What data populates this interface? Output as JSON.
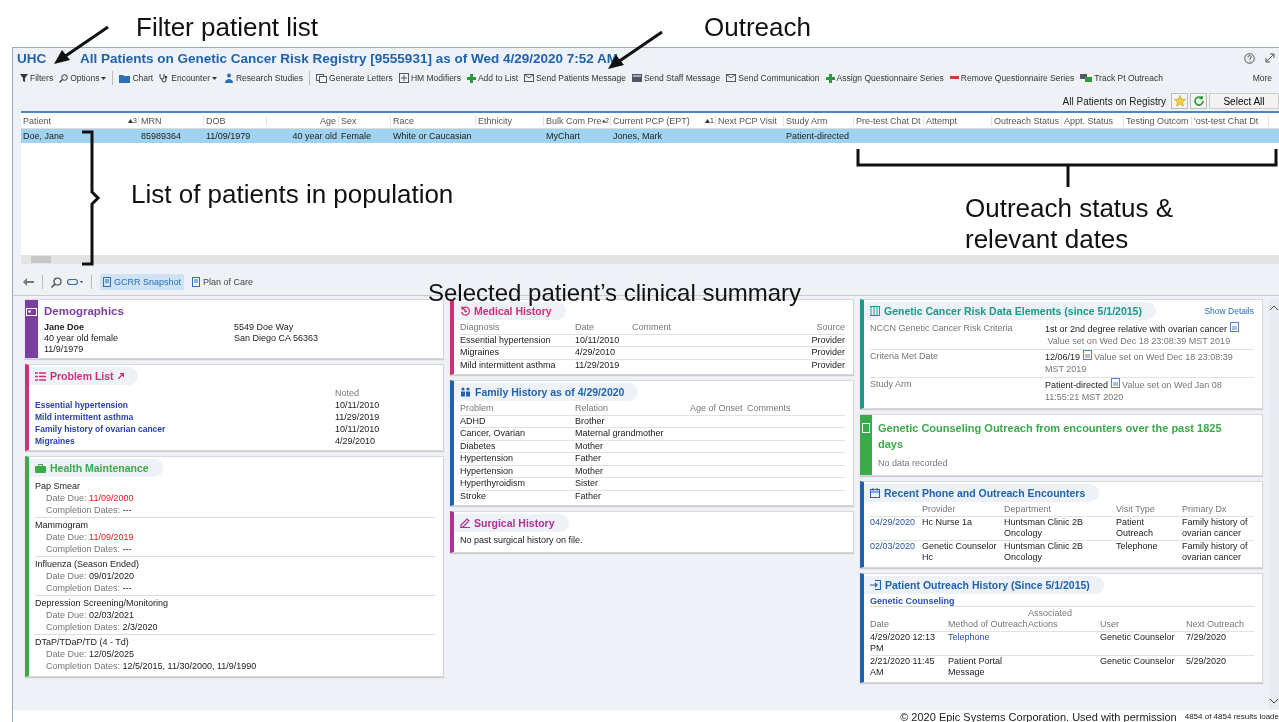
{
  "callouts": {
    "filter": "Filter patient list",
    "outreach": "Outreach",
    "patient_list": "List of patients in population",
    "outreach_status": "Outreach status & relevant dates",
    "clinical_summary": "Selected patient’s clinical summary"
  },
  "window": {
    "title_prefix": "UHC",
    "title": "All Patients on Genetic Cancer Risk Registry [9555931] as of Wed 4/29/2020  7:52 AM"
  },
  "toolbar": [
    {
      "label": "Filters",
      "dropdown": false
    },
    {
      "label": "Options",
      "dropdown": true
    },
    {
      "label": "Chart",
      "dropdown": false
    },
    {
      "label": "Encounter",
      "dropdown": true
    },
    {
      "label": "Research Studies",
      "dropdown": false
    },
    {
      "label": "Generate Letters",
      "dropdown": false
    },
    {
      "label": "HM Modifiers",
      "dropdown": false
    },
    {
      "label": "Add to List",
      "dropdown": false
    },
    {
      "label": "Send Patients Message",
      "dropdown": false
    },
    {
      "label": "Send Staff Message",
      "dropdown": false
    },
    {
      "label": "Send Communication",
      "dropdown": false
    },
    {
      "label": "Assign Questionnaire Series",
      "dropdown": false
    },
    {
      "label": "Remove Questionnaire Series",
      "dropdown": false
    },
    {
      "label": "Track Pt Outreach",
      "dropdown": false
    },
    {
      "label": "More",
      "dropdown": false
    }
  ],
  "list_bar": {
    "label": "All Patients on Registry",
    "button": "Select All"
  },
  "table": {
    "columns": [
      {
        "label": "Patient",
        "sort_rank": "3"
      },
      {
        "label": "MRN"
      },
      {
        "label": "DOB"
      },
      {
        "label": "Age"
      },
      {
        "label": "Sex"
      },
      {
        "label": "Race"
      },
      {
        "label": "Ethnicity"
      },
      {
        "label": "Bulk Com Pre",
        "sort_rank": "2"
      },
      {
        "label": "Current PCP (EPT)",
        "sort_rank": "1"
      },
      {
        "label": "Next PCP Visit"
      },
      {
        "label": "Study Arm"
      },
      {
        "label": "Pre-test Chat Dt"
      },
      {
        "label": "Attempt"
      },
      {
        "label": "Outreach Status"
      },
      {
        "label": "Appt. Status"
      },
      {
        "label": "Testing Outcom"
      },
      {
        "label": "'ost-test Chat Dt"
      }
    ],
    "rows": [
      {
        "selected": true,
        "cells": [
          "Doe, Jane",
          "85989364",
          "11/09/1979",
          "40 year old",
          "Female",
          "White or Caucasian",
          null,
          "MyChart",
          "Jones, Mark",
          null,
          "Patient-directed",
          null,
          null,
          null,
          null,
          null,
          null
        ]
      }
    ]
  },
  "snapshot_bar": {
    "tabs": [
      {
        "label": "GCRR Snapshot",
        "selected": true
      },
      {
        "label": "Plan of Care",
        "selected": false
      }
    ]
  },
  "columns": [
    [
      {
        "kind": "demographics",
        "title": "Demographics",
        "color": "#7b3fa0",
        "name": "Jane Doe",
        "lines": [
          "40 year old female",
          "11/9/1979"
        ],
        "address": [
          "5549 Doe Way",
          "San Diego CA 56363"
        ]
      },
      {
        "kind": "problems",
        "title": "Problem List",
        "color": "#d0307a",
        "noted_label": "Noted",
        "items": [
          {
            "name": "Essential hypertension",
            "date": "10/11/2010"
          },
          {
            "name": "Mild intermittent asthma",
            "date": "11/29/2019"
          },
          {
            "name": "Family history of ovarian cancer",
            "date": "10/11/2010"
          },
          {
            "name": "Migraines",
            "date": "4/29/2010"
          }
        ]
      },
      {
        "kind": "maintenance",
        "title": "Health Maintenance",
        "color": "#3aaa4a",
        "items": [
          {
            "name": "Pap Smear",
            "due_label": "Date Due:",
            "due": "11/09/2000",
            "overdue": true,
            "completion_label": "Completion Dates:",
            "completion": "---"
          },
          {
            "name": "Mammogram",
            "due_label": "Date Due:",
            "due": "11/09/2019",
            "overdue": true,
            "completion_label": "Completion Dates:",
            "completion": "---"
          },
          {
            "name": "Influenza (Season Ended)",
            "due_label": "Date Due:",
            "due": "09/01/2020",
            "overdue": false,
            "completion_label": "Completion Dates:",
            "completion": "---"
          },
          {
            "name": "Depression Screening/Monitoring",
            "due_label": "Date Due:",
            "due": "02/03/2021",
            "overdue": false,
            "completion_label": "Completion Dates:",
            "completion": "2/3/2020"
          },
          {
            "name": "DTaP/TDaP/TD (4 - Td)",
            "due_label": "Date Due:",
            "due": "12/05/2025",
            "overdue": false,
            "completion_label": "Completion Dates:",
            "completion": "12/5/2015, 11/30/2000, 11/9/1990"
          }
        ]
      }
    ],
    [
      {
        "kind": "table",
        "title": "Medical History",
        "color": "#d0307a",
        "columns": [
          "Diagnosis",
          "Date",
          "Comment",
          "Source"
        ],
        "rows": [
          [
            "Essential hypertension",
            "10/11/2010",
            null,
            "Provider"
          ],
          [
            "Migraines",
            "4/29/2010",
            null,
            "Provider"
          ],
          [
            "Mild intermittent asthma",
            "11/29/2019",
            null,
            "Provider"
          ]
        ]
      },
      {
        "kind": "table",
        "title": "Family History as of 4/29/2020",
        "color": "#1f63b0",
        "columns": [
          "Problem",
          "Relation",
          "Age of Onset",
          "Comments"
        ],
        "rows": [
          [
            "ADHD",
            "Brother",
            null,
            null
          ],
          [
            "Cancer, Ovarian",
            "Maternal grandmother",
            null,
            null
          ],
          [
            "Diabetes",
            "Mother",
            null,
            null
          ],
          [
            "Hypertension",
            "Father",
            null,
            null
          ],
          [
            "Hypertension",
            "Mother",
            null,
            null
          ],
          [
            "Hyperthyroidism",
            "Sister",
            null,
            null
          ],
          [
            "Stroke",
            "Father",
            null,
            null
          ]
        ]
      },
      {
        "kind": "text",
        "title": "Surgical History",
        "color": "#b0309a",
        "text": "No past surgical history on file."
      }
    ],
    [
      {
        "kind": "data_elements",
        "title": "Genetic Cancer Risk Data Elements (since 5/1/2015)",
        "color": "#1a9a8a",
        "action": "Show Details",
        "rows": [
          {
            "label": "NCCN Genetic Cancer Risk Criteria",
            "value": "1st or 2nd degree relative with ovarian cancer",
            "note": "Value set on Wed Dec 18 23:08:39 MST 2019"
          },
          {
            "label": "Criteria Met Date",
            "value": "12/06/19",
            "note": "Value set on Wed Dec 18 23:08:39 MST 2019"
          },
          {
            "label": "Study Arm",
            "value": "Patient-directed",
            "note": "Value set on Wed Jan 08 11:55:21 MST 2020"
          }
        ]
      },
      {
        "kind": "notice",
        "title": "Genetic Counseling Outreach from encounters over the past 1825 days",
        "color": "#3aaa4a",
        "text": "No data recorded"
      },
      {
        "kind": "table",
        "title": "Recent Phone and Outreach Encounters",
        "color": "#1f63b0",
        "columns": [
          null,
          "Provider",
          "Department",
          "Visit Type",
          "Primary Dx"
        ],
        "rows": [
          [
            "04/29/2020",
            "Hc Nurse 1a",
            "Huntsman Clinic 2B Oncology",
            "Patient Outreach",
            "Family history of ovarian cancer"
          ],
          [
            "02/03/2020",
            "Genetic Counselor Hc",
            "Huntsman Clinic 2B Oncology",
            "Telephone",
            "Family history of ovarian cancer"
          ]
        ]
      },
      {
        "kind": "outreach_history",
        "title": "Patient Outreach History (Since 5/1/2015)",
        "color": "#1f63b0",
        "section": "Genetic Counseling",
        "columns": [
          "Date",
          "Method of Outreach",
          "Associated Actions",
          "User",
          "Next Outreach"
        ],
        "rows": [
          [
            "4/29/2020 12:13 PM",
            "Telephone",
            null,
            "Genetic Counselor",
            "7/29/2020"
          ],
          [
            "2/21/2020 11:45 AM",
            "Patient Portal Message",
            null,
            "Genetic Counselor",
            "5/29/2020"
          ]
        ]
      }
    ]
  ],
  "footer": {
    "copyright": "© 2020 Epic Systems Corporation. Used with permission",
    "results": "4854 of 4854 results loade"
  }
}
